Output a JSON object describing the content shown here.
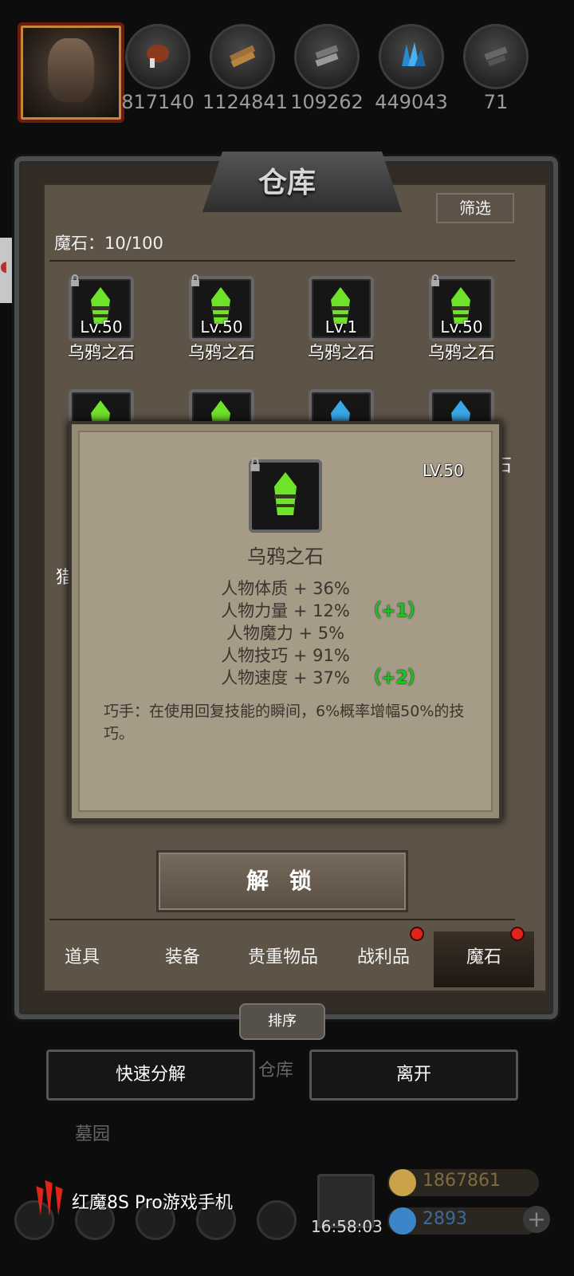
{
  "resources": [
    {
      "icon": "meat-icon",
      "value": "817140"
    },
    {
      "icon": "wood-icon",
      "value": "1124841"
    },
    {
      "icon": "iron-icon",
      "value": "109262"
    },
    {
      "icon": "crystal-icon",
      "value": "449043"
    },
    {
      "icon": "ore-icon",
      "value": "71"
    }
  ],
  "panel": {
    "title": "仓库",
    "filter_label": "筛选",
    "count_label": "魔石：10/100"
  },
  "grid": [
    {
      "level": "Lv.50",
      "name": "乌鸦之石",
      "locked": true,
      "color": "green"
    },
    {
      "level": "Lv.50",
      "name": "乌鸦之石",
      "locked": true,
      "color": "green"
    },
    {
      "level": "Lv.1",
      "name": "乌鸦之石",
      "locked": false,
      "color": "green"
    },
    {
      "level": "Lv.50",
      "name": "乌鸦之石",
      "locked": true,
      "color": "green"
    }
  ],
  "tooltip": {
    "level": "LV.50",
    "name": "乌鸦之石",
    "stats": [
      {
        "text": "人物体质 + 36%",
        "bonus": ""
      },
      {
        "text": "人物力量 + 12%",
        "bonus": "（+1）"
      },
      {
        "text": "人物魔力 + 5%",
        "bonus": ""
      },
      {
        "text": "人物技巧 + 91%",
        "bonus": ""
      },
      {
        "text": "人物速度 + 37%",
        "bonus": "（+2）"
      }
    ],
    "description": "巧手：在使用回复技能的瞬间，6%概率增幅50%的技巧。"
  },
  "unlock_label": "解 锁",
  "tabs": [
    {
      "label": "道具",
      "dot": false,
      "active": false
    },
    {
      "label": "装备",
      "dot": false,
      "active": false
    },
    {
      "label": "贵重物品",
      "dot": false,
      "active": false
    },
    {
      "label": "战利品",
      "dot": true,
      "active": false
    },
    {
      "label": "魔石",
      "dot": true,
      "active": true
    }
  ],
  "sort_label": "排序",
  "quick_decompose_label": "快速分解",
  "leave_label": "离开",
  "behind": {
    "warehouse": "仓库",
    "cemetery": "墓园",
    "partial_item": "猎",
    "partial_stone": "石"
  },
  "footer": {
    "brand": "红魔8S Pro游戏手机",
    "time": "16:58:03",
    "gold": "1867861",
    "gems": "2893"
  },
  "colors": {
    "accent_green": "#14c81e",
    "badge_red": "#e0241a"
  }
}
